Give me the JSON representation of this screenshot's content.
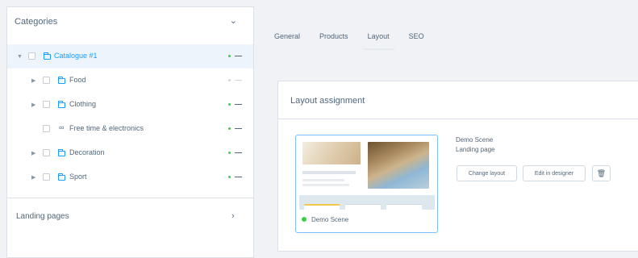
{
  "sidebar": {
    "title": "Categories",
    "tree": [
      {
        "label": "Catalogue #1",
        "icon": "folder-icon",
        "active": true
      },
      {
        "label": "Food",
        "icon": "folder-icon",
        "active": false
      },
      {
        "label": "Clothing",
        "icon": "folder-icon",
        "active": false
      },
      {
        "label": "Free time & electronics",
        "icon": "link-icon",
        "active": false
      },
      {
        "label": "Decoration",
        "icon": "folder-icon",
        "active": false
      },
      {
        "label": "Sport",
        "icon": "folder-icon",
        "active": false
      }
    ],
    "landing_pages": "Landing pages"
  },
  "tabs": [
    "General",
    "Products",
    "Layout",
    "SEO"
  ],
  "active_tab": "Layout",
  "card": {
    "title": "Layout assignment",
    "preview_name": "Demo Scene",
    "layout_name": "Demo Scene",
    "layout_type": "Landing page",
    "change_label": "Change layout",
    "edit_label": "Edit in designer"
  },
  "colors": {
    "accent": "#189eff",
    "status_active": "#37d046"
  }
}
